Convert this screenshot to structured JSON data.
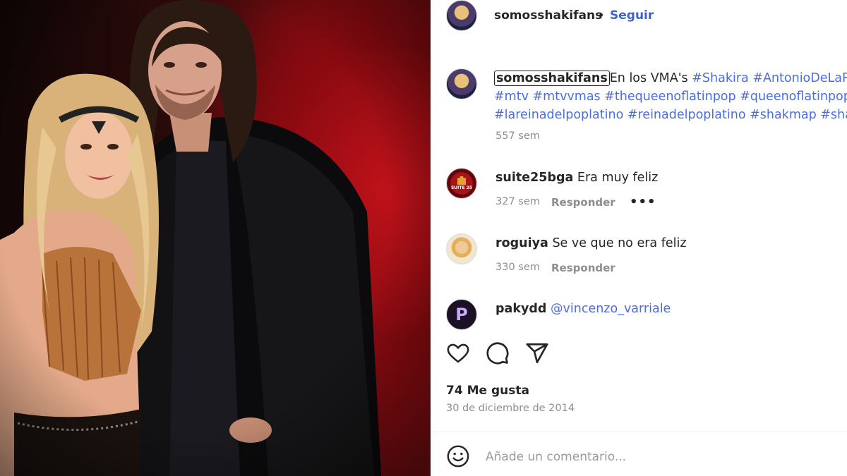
{
  "post": {
    "author": "somosshakifans",
    "separator": "•",
    "follow_label": "Seguir"
  },
  "caption": {
    "username": "somosshakifans",
    "text": "En los VMA's",
    "line1_tags": "#Shakira #AntonioDeLaRua",
    "line2_tags": "#mtv #mtvvmas #thequeenoflatinpop #queenoflatinpop",
    "line3_tags": "#lareinadelpoplatino #reinadelpoplatino #shakmap #shak",
    "age": "557 sem"
  },
  "comments": [
    {
      "username": "suite25bga",
      "text": "Era muy feliz",
      "age": "327 sem",
      "reply": "Responder",
      "more": "•••",
      "avatar_text": "SUITE 25"
    },
    {
      "username": "roguiya",
      "text": "Se ve que no era feliz",
      "age": "330 sem",
      "reply": "Responder"
    },
    {
      "username": "pakydd",
      "mention": "@vincenzo_varriale",
      "avatar_text": "P"
    }
  ],
  "actions": {
    "like_icon": "heart-icon",
    "comment_icon": "speech-bubble-icon",
    "share_icon": "paper-plane-icon"
  },
  "likes_text": "74 Me gusta",
  "date_text": "30 de diciembre de 2014",
  "add_comment": {
    "emoji_icon": "smiley-icon",
    "placeholder": "Añade un comentario..."
  },
  "colors": {
    "link": "#4a6ee0",
    "follow": "#3b63c9",
    "muted": "#8e8e8e",
    "photo_red": "#9b1016"
  }
}
